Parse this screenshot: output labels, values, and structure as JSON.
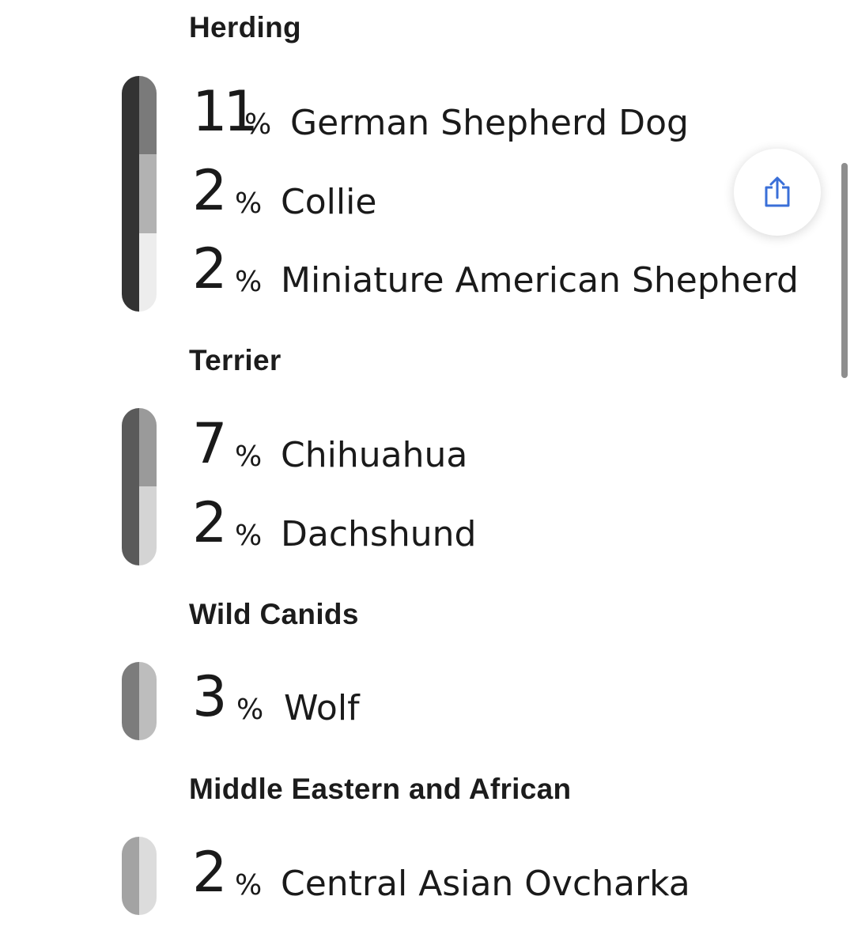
{
  "colors": {
    "text": "#1b1b1b",
    "share_icon": "#3a6fd8",
    "scrollbar": "#8e8e8e"
  },
  "share_button": {
    "icon": "share-icon"
  },
  "groups": [
    {
      "name": "Herding",
      "outer_color": "#333333",
      "breeds": [
        {
          "percent": "11",
          "sign": "%",
          "name": "German Shepherd Dog",
          "color": "#7a7a7a"
        },
        {
          "percent": "2",
          "sign": "%",
          "name": "Collie",
          "color": "#b2b2b2"
        },
        {
          "percent": "2",
          "sign": "%",
          "name": "Miniature American Shepherd",
          "color": "#ededed"
        }
      ]
    },
    {
      "name": "Terrier",
      "outer_color": "#5a5a5a",
      "breeds": [
        {
          "percent": "7",
          "sign": "%",
          "name": "Chihuahua",
          "color": "#9a9a9a"
        },
        {
          "percent": "2",
          "sign": "%",
          "name": "Dachshund",
          "color": "#d4d4d4"
        }
      ]
    },
    {
      "name": "Wild Canids",
      "outer_color": "#7c7c7c",
      "breeds": [
        {
          "percent": "3",
          "sign": "%",
          "name": "Wolf",
          "color": "#bdbdbd"
        }
      ]
    },
    {
      "name": "Middle Eastern and African",
      "outer_color": "#a3a3a3",
      "breeds": [
        {
          "percent": "2",
          "sign": "%",
          "name": "Central Asian Ovcharka",
          "color": "#dcdcdc"
        }
      ]
    }
  ]
}
